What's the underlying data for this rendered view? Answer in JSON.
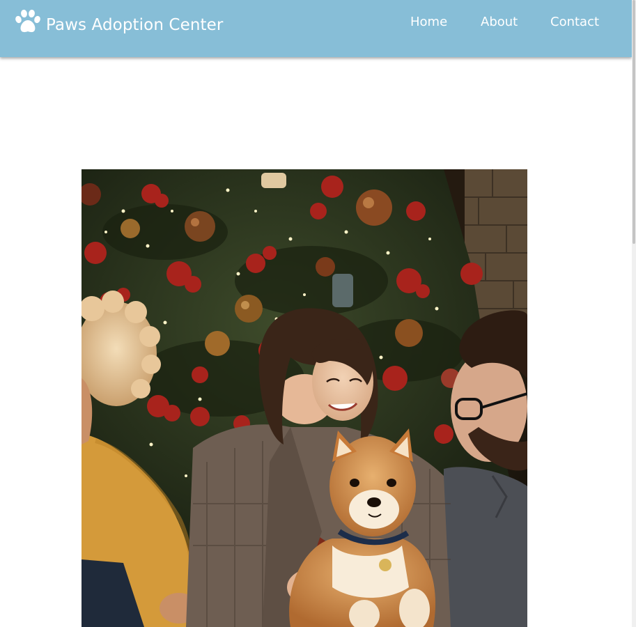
{
  "header": {
    "brand_icon": "paw-icon",
    "brand_name": "Paws Adoption Center",
    "background": "#87bed7",
    "nav": {
      "home": "Home",
      "about": "About",
      "contact": "Contact"
    }
  },
  "main": {
    "hero_image": "photo-people-with-shiba-inu-dog-by-christmas-tree"
  }
}
